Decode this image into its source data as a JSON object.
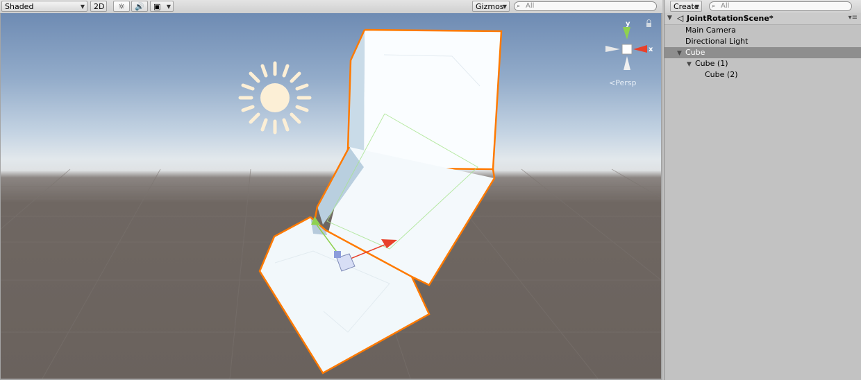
{
  "scene_toolbar": {
    "shading_mode": "Shaded",
    "mode_2d": "2D",
    "gizmos_label": "Gizmos",
    "search_text": "All"
  },
  "scene_view": {
    "camera_label": "Persp",
    "axis_labels": {
      "y": "y",
      "x": "x"
    }
  },
  "hierarchy": {
    "create_label": "Create",
    "search_text": "All",
    "scene_name": "JointRotationScene*",
    "items": [
      {
        "label": "Main Camera",
        "depth": 0,
        "selected": false
      },
      {
        "label": "Directional Light",
        "depth": 0,
        "selected": false
      },
      {
        "label": "Cube",
        "depth": 0,
        "selected": true
      },
      {
        "label": "Cube (1)",
        "depth": 1,
        "selected": false
      },
      {
        "label": "Cube (2)",
        "depth": 2,
        "selected": false
      }
    ]
  },
  "colors": {
    "selection_outline": "#ff7a00",
    "selected_row": "#8e8e8e",
    "axis_x": "#e8402a",
    "axis_y": "#8fd14f"
  }
}
